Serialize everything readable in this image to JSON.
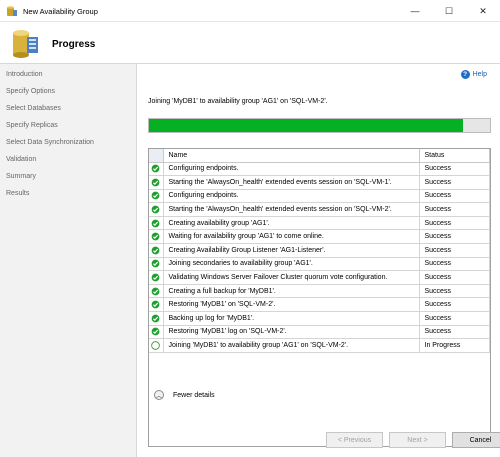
{
  "window": {
    "title": "New Availability Group",
    "minimize_glyph": "—",
    "maximize_glyph": "☐",
    "close_glyph": "✕"
  },
  "header": {
    "title": "Progress",
    "icon": "database-wizard-icon"
  },
  "sidebar": {
    "items": [
      {
        "label": "Introduction"
      },
      {
        "label": "Specify Options"
      },
      {
        "label": "Select Databases"
      },
      {
        "label": "Specify Replicas"
      },
      {
        "label": "Select Data Synchronization"
      },
      {
        "label": "Validation"
      },
      {
        "label": "Summary"
      },
      {
        "label": "Results"
      }
    ]
  },
  "main": {
    "help_label": "Help",
    "status_message": "Joining 'MyDB1' to availability group 'AG1' on 'SQL-VM-2'.",
    "progress_fraction": 0.92,
    "progress_color": "#06b025",
    "grid": {
      "columns": {
        "name": "Name",
        "status": "Status"
      },
      "rows": [
        {
          "name": "Configuring endpoints.",
          "status": "Success",
          "state": "success"
        },
        {
          "name": "Starting the 'AlwaysOn_health' extended events session on 'SQL-VM-1'.",
          "status": "Success",
          "state": "success"
        },
        {
          "name": "Configuring endpoints.",
          "status": "Success",
          "state": "success"
        },
        {
          "name": "Starting the 'AlwaysOn_health' extended events session on 'SQL-VM-2'.",
          "status": "Success",
          "state": "success"
        },
        {
          "name": "Creating availability group 'AG1'.",
          "status": "Success",
          "state": "success"
        },
        {
          "name": "Waiting for availability group 'AG1' to come online.",
          "status": "Success",
          "state": "success"
        },
        {
          "name": "Creating Availability Group Listener 'AG1-Listener'.",
          "status": "Success",
          "state": "success"
        },
        {
          "name": "Joining secondaries to availability group 'AG1'.",
          "status": "Success",
          "state": "success"
        },
        {
          "name": "Validating Windows Server Failover Cluster quorum vote configuration.",
          "status": "Success",
          "state": "success"
        },
        {
          "name": "Creating a full backup for 'MyDB1'.",
          "status": "Success",
          "state": "success"
        },
        {
          "name": "Restoring 'MyDB1' on 'SQL-VM-2'.",
          "status": "Success",
          "state": "success"
        },
        {
          "name": "Backing up log for 'MyDB1'.",
          "status": "Success",
          "state": "success"
        },
        {
          "name": "Restoring 'MyDB1' log on 'SQL-VM-2'.",
          "status": "Success",
          "state": "success"
        },
        {
          "name": "Joining 'MyDB1' to availability group 'AG1' on 'SQL-VM-2'.",
          "status": "In Progress",
          "state": "in-progress"
        }
      ]
    },
    "fewer_details_label": "Fewer details"
  },
  "buttons": {
    "previous": "< Previous",
    "next": "Next >",
    "cancel": "Cancel"
  },
  "colors": {
    "success": "#1e9e2e",
    "in_progress_outline": "#3a9a3a"
  }
}
